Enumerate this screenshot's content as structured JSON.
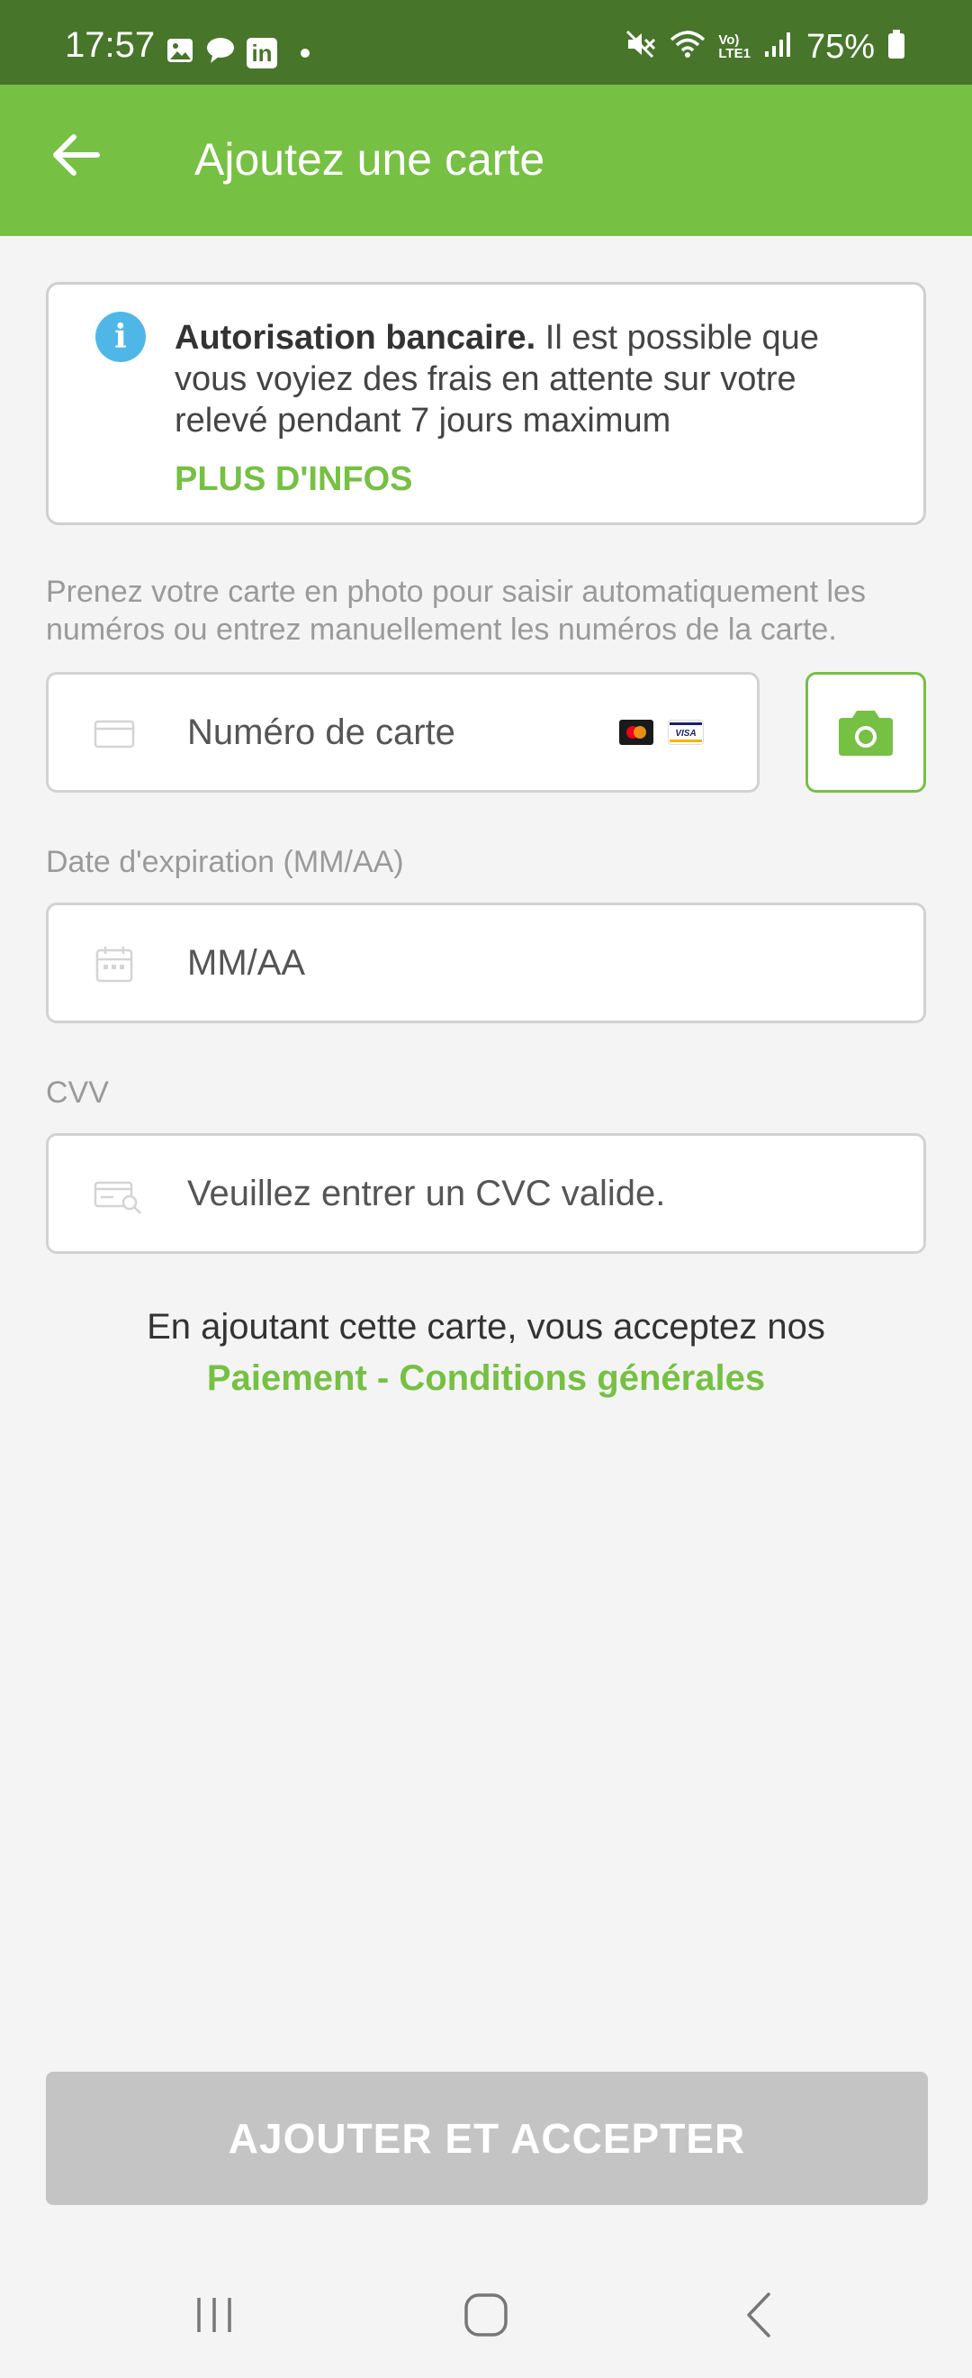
{
  "status_bar": {
    "time": "17:57",
    "battery_percent": "75%",
    "left_icons": [
      "gallery-icon",
      "chat-icon",
      "linkedin-icon",
      "dot-icon"
    ],
    "right_icons": [
      "mute-icon",
      "wifi-icon",
      "volte-icon",
      "signal-icon",
      "battery-icon"
    ],
    "linkedin_label": "in",
    "volte_label_1": "Vo)",
    "volte_label_2": "LTE1"
  },
  "app_bar": {
    "title": "Ajoutez une carte",
    "background": "#76c043"
  },
  "info_card": {
    "title": "Autorisation bancaire.",
    "body": " Il est possible que vous voyiez des frais en attente sur votre relevé pendant 7 jours maximum",
    "link": "PLUS D'INFOS",
    "icon_glyph": "i"
  },
  "helper_text": "Prenez votre carte en photo pour saisir automatiquement les numéros ou entrez manuellement les numéros de la carte.",
  "card_number": {
    "placeholder": "Numéro de carte",
    "brands": [
      "mastercard",
      "visa"
    ],
    "visa_label": "VISA"
  },
  "expiry": {
    "label": "Date d'expiration (MM/AA)",
    "placeholder": "MM/AA"
  },
  "cvv": {
    "label": "CVV",
    "placeholder": "Veuillez entrer un CVC valide."
  },
  "terms": {
    "line": "En ajoutant cette carte, vous acceptez nos",
    "link": "Paiement - Conditions générales"
  },
  "submit_button": {
    "label": "AJOUTER ET ACCEPTER"
  },
  "colors": {
    "accent": "#76c043",
    "status_bar": "#47752a",
    "disabled_button": "#c4c4c4",
    "info_icon": "#4fb7e8"
  }
}
